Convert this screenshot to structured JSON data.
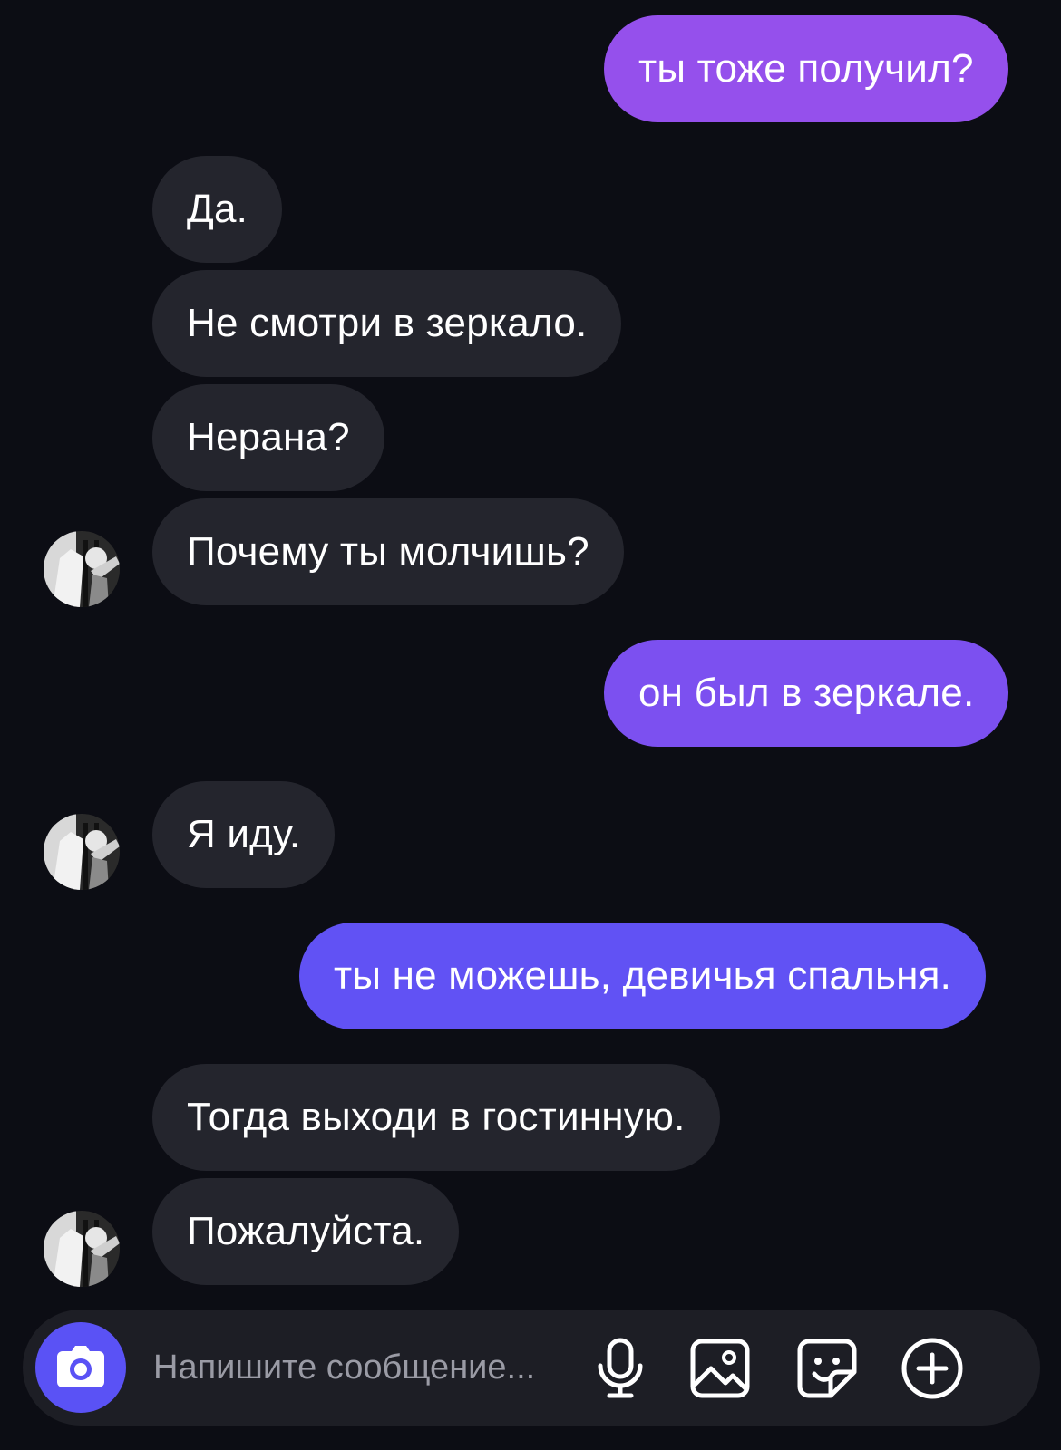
{
  "messages": [
    {
      "direction": "outgoing",
      "text": "ты тоже получил?"
    },
    {
      "direction": "incoming",
      "text": "Да."
    },
    {
      "direction": "incoming",
      "text": "Не смотри в зеркало."
    },
    {
      "direction": "incoming",
      "text": "Нерана?"
    },
    {
      "direction": "incoming",
      "text": "Почему ты молчишь?"
    },
    {
      "direction": "outgoing",
      "text": "он был в зеркале."
    },
    {
      "direction": "incoming",
      "text": "Я иду."
    },
    {
      "direction": "outgoing",
      "text": "ты не можешь, девичья спальня."
    },
    {
      "direction": "incoming",
      "text": "Тогда выходи в гостинную."
    },
    {
      "direction": "incoming",
      "text": "Пожалуйста."
    }
  ],
  "composer": {
    "placeholder": "Напишите сообщение...",
    "icons": [
      "camera-icon",
      "microphone-icon",
      "image-icon",
      "sticker-icon",
      "plus-icon"
    ]
  },
  "colors": {
    "background": "#0c0d14",
    "incoming_bubble": "#24252d",
    "outgoing_top": "#9d4fe8",
    "outgoing_bottom": "#5a52f5",
    "camera_button": "#5a52f5",
    "composer": "#1d1e25"
  }
}
